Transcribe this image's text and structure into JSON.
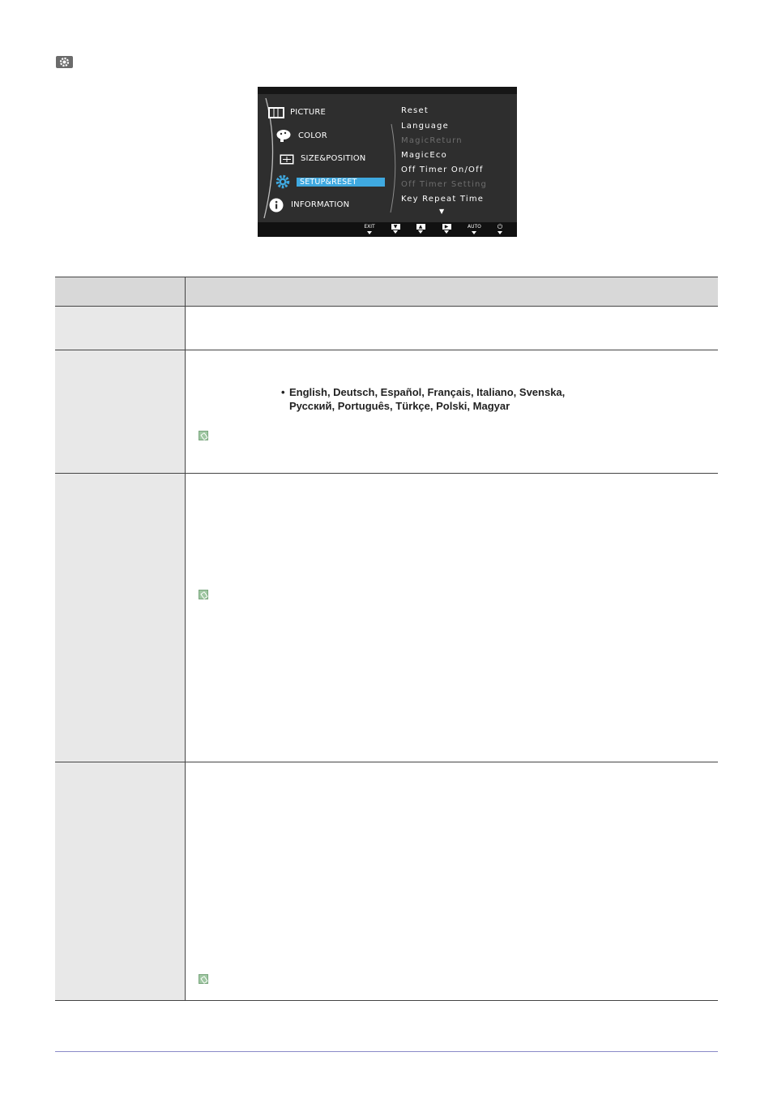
{
  "osd": {
    "main_menu": [
      {
        "label": "PICTURE",
        "icon": "picture-icon"
      },
      {
        "label": "COLOR",
        "icon": "color-palette-icon"
      },
      {
        "label": "SIZE&POSITION",
        "icon": "size-position-icon"
      },
      {
        "label": "SETUP&RESET",
        "icon": "gear-icon",
        "selected": true
      },
      {
        "label": "INFORMATION",
        "icon": "info-icon"
      }
    ],
    "sub_menu": [
      {
        "label": "Reset",
        "enabled": true
      },
      {
        "label": "Language",
        "enabled": true
      },
      {
        "label": "MagicReturn",
        "enabled": false
      },
      {
        "label": "MagicEco",
        "enabled": true
      },
      {
        "label": "Off Timer On/Off",
        "enabled": true
      },
      {
        "label": "Off Timer Setting",
        "enabled": false
      },
      {
        "label": "Key Repeat Time",
        "enabled": true
      }
    ],
    "more_indicator": "▼",
    "buttons": [
      {
        "label": "EXIT",
        "icon": "exit-icon"
      },
      {
        "label": "▼",
        "icon": "down-arrow-icon"
      },
      {
        "label": "▲",
        "icon": "up-arrow-icon"
      },
      {
        "label": "▶",
        "icon": "enter-icon"
      },
      {
        "label": "AUTO",
        "icon": "auto-icon"
      },
      {
        "label": "⏻",
        "icon": "power-icon"
      }
    ],
    "highlight_color": "#3fa9e0"
  },
  "table": {
    "languages_line1": "English, Deutsch, Español, Français, Italiano, Svenska,",
    "languages_line2": "Русский, Português, Türkçe, Polski, Magyar",
    "bullet": "•"
  }
}
